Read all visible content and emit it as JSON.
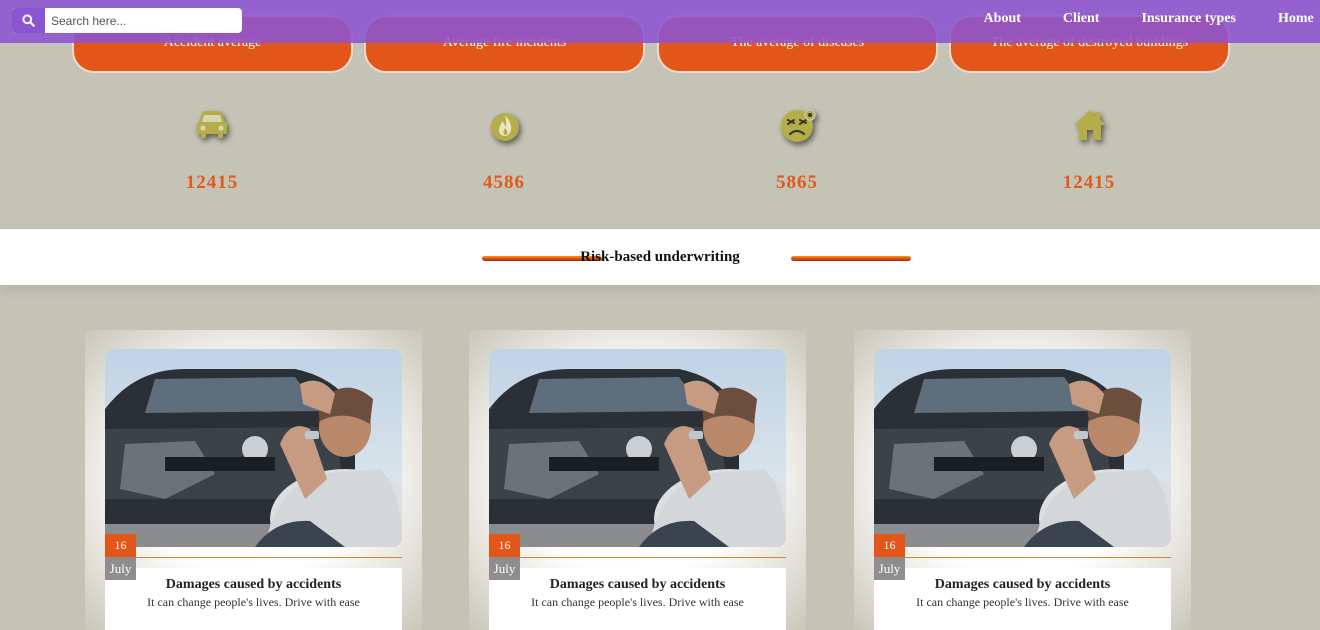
{
  "search": {
    "placeholder": "Search here...",
    "icon": "search-icon"
  },
  "nav": {
    "items": [
      "About",
      "Client",
      "Insurance types",
      "Home"
    ]
  },
  "stats": [
    {
      "label": "Accident average",
      "value": "12415",
      "icon": "car-icon"
    },
    {
      "label": "Average fire incidents",
      "value": "4586",
      "icon": "fire-icon"
    },
    {
      "label": "The average of diseases",
      "value": "5865",
      "icon": "sick-face-icon"
    },
    {
      "label": "The average of destroyed buildings",
      "value": "12415",
      "icon": "home-icon"
    }
  ],
  "section": {
    "title": "Risk-based underwriting"
  },
  "articles": [
    {
      "day": "16",
      "month": "July",
      "title": "Damages caused by accidents",
      "subtitle": "It can change people's lives. Drive with ease"
    },
    {
      "day": "16",
      "month": "July",
      "title": "Damages caused by accidents",
      "subtitle": "It can change people's lives. Drive with ease"
    },
    {
      "day": "16",
      "month": "July",
      "title": "Damages caused by accidents",
      "subtitle": "It can change people's lives. Drive with ease"
    }
  ],
  "colors": {
    "nav": "#8c54d2",
    "accent": "#e35619",
    "icon": "#b5ad4a",
    "background": "#c5c3b6"
  }
}
